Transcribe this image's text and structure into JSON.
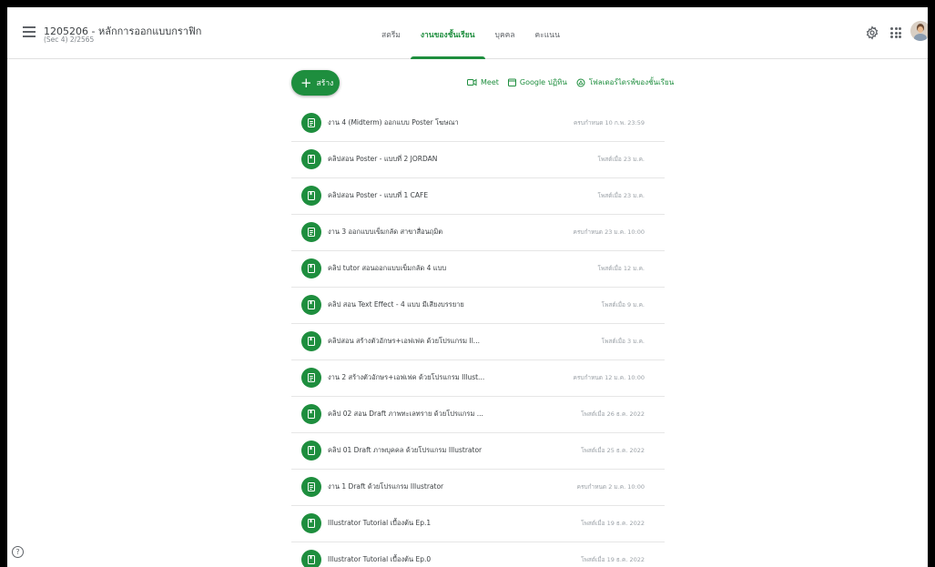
{
  "header": {
    "class_title": "1205206 - หลักการออกแบบกราฟิก",
    "class_subtitle": "(Sec 4) 2/2565",
    "tabs": [
      {
        "label": "สตรีม"
      },
      {
        "label": "งานของชั้นเรียน"
      },
      {
        "label": "บุคคล"
      },
      {
        "label": "คะแนน"
      }
    ],
    "active_tab": "งานของชั้นเรียน"
  },
  "toolbar": {
    "create_label": "สร้าง",
    "meet_label": "Meet",
    "calendar_label": "Google ปฏิทิน",
    "drive_label": "โฟลเดอร์ไดรฟ์ของชั้นเรียน"
  },
  "colors": {
    "accent": "#1e8e3e"
  },
  "items": [
    {
      "type": "assignment",
      "icon": "assignment-icon",
      "title": "งาน 4 (Midterm) ออกแบบ Poster โฆษณา",
      "date": "ครบกำหนด 10 ก.พ. 23:59"
    },
    {
      "type": "material",
      "icon": "material-icon",
      "title": "คลิปสอน Poster - แบบที่ 2 JORDAN",
      "date": "โพสต์เมื่อ 23 ม.ค."
    },
    {
      "type": "material",
      "icon": "material-icon",
      "title": "คลิปสอน Poster - แบบที่ 1 CAFE",
      "date": "โพสต์เมื่อ 23 ม.ค."
    },
    {
      "type": "assignment",
      "icon": "assignment-icon",
      "title": "งาน 3 ออกแบบเข็มกลัด สาขาสื่อนฤมิต",
      "date": "ครบกำหนด 23 ม.ค. 10:00"
    },
    {
      "type": "material",
      "icon": "material-icon",
      "title": "คลิป tutor สอนออกแบบเข็มกลัด 4 แบบ",
      "date": "โพสต์เมื่อ 12 ม.ค."
    },
    {
      "type": "material",
      "icon": "material-icon",
      "title": "คลิป สอน Text Effect - 4 แบบ มีเสียงบรรยาย",
      "date": "โพสต์เมื่อ 9 ม.ค."
    },
    {
      "type": "material",
      "icon": "material-icon",
      "title": "คลิปสอน สร้างตัวอักษร+เอฟเฟค ด้วยโปรแกรม Il...",
      "date": "โพสต์เมื่อ 3 ม.ค."
    },
    {
      "type": "assignment",
      "icon": "assignment-icon",
      "title": "งาน 2 สร้างตัวอักษร+เอฟเฟค ด้วยโปรแกรม Illust...",
      "date": "ครบกำหนด 12 ม.ค. 10:00"
    },
    {
      "type": "material",
      "icon": "material-icon",
      "title": "คลิป 02 สอน Draft ภาพทะเลทราย ด้วยโปรแกรม ...",
      "date": "โพสต์เมื่อ 26 ธ.ค. 2022"
    },
    {
      "type": "material",
      "icon": "material-icon",
      "title": "คลิป 01 Draft ภาพบุคคล ด้วยโปรแกรม Illustrator",
      "date": "โพสต์เมื่อ 25 ธ.ค. 2022"
    },
    {
      "type": "assignment",
      "icon": "assignment-icon",
      "title": "งาน 1 Draft ด้วยโปรแกรม Illustrator",
      "date": "ครบกำหนด 2 ม.ค. 10:00"
    },
    {
      "type": "material",
      "icon": "material-icon",
      "title": "Illustrator Tutorial เบื้องต้น Ep.1",
      "date": "โพสต์เมื่อ 19 ธ.ค. 2022"
    },
    {
      "type": "material",
      "icon": "material-icon",
      "title": "Illustrator Tutorial เบื้องต้น Ep.0",
      "date": "โพสต์เมื่อ 19 ธ.ค. 2022"
    }
  ]
}
